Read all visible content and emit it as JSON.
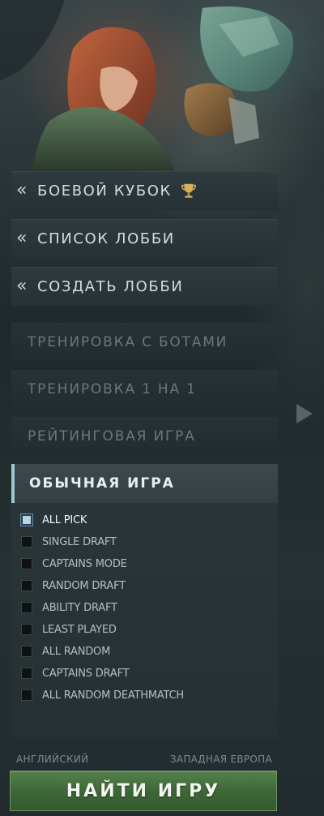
{
  "menu": {
    "battle_cup": "БОЕВОЙ КУБОК",
    "lobby_list": "СПИСОК ЛОББИ",
    "create_lobby": "СОЗДАТЬ ЛОББИ",
    "bot_practice": "ТРЕНИРОВКА С БОТАМИ",
    "practice_1v1": "ТРЕНИРОВКА 1 НА 1",
    "ranked": "РЕЙТИНГОВАЯ ИГРА",
    "unranked": "ОБЫЧНАЯ ИГРА"
  },
  "modes": [
    {
      "label": "ALL PICK",
      "checked": true
    },
    {
      "label": "SINGLE DRAFT",
      "checked": false
    },
    {
      "label": "CAPTAINS MODE",
      "checked": false
    },
    {
      "label": "RANDOM DRAFT",
      "checked": false
    },
    {
      "label": "ABILITY DRAFT",
      "checked": false
    },
    {
      "label": "LEAST PLAYED",
      "checked": false
    },
    {
      "label": "ALL RANDOM",
      "checked": false
    },
    {
      "label": "CAPTAINS DRAFT",
      "checked": false
    },
    {
      "label": "ALL RANDOM DEATHMATCH",
      "checked": false
    }
  ],
  "footer": {
    "language": "АНГЛИЙСКИЙ",
    "region": "ЗАПАДНАЯ ЕВРОПА",
    "find_match": "НАЙТИ ИГРУ"
  },
  "icons": {
    "chevron": "double-chevron-left-icon",
    "trophy": "trophy-icon",
    "arrow": "arrow-right-icon"
  },
  "colors": {
    "accent_active": "#9fc6cf",
    "find_button": "#3d6636"
  }
}
